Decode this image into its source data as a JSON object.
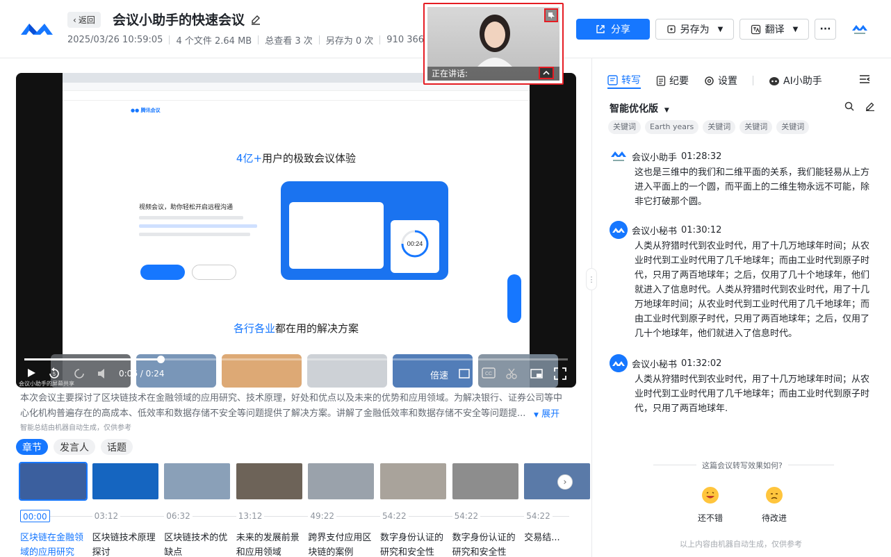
{
  "header": {
    "back_label": "返回",
    "title": "会议小助手的快速会议",
    "datetime": "2025/03/26 10:59:05",
    "files": "4 个文件 2.64 MB",
    "views": "总查看 3 次",
    "saves": "另存为 0 次",
    "meeting_id": "910 366 156",
    "share_label": "分享",
    "saveas_label": "另存为",
    "translate_label": "翻译",
    "more_label": "···"
  },
  "speaker_window": {
    "label": "正在讲话:"
  },
  "video": {
    "site_headline_accent": "4亿+",
    "site_headline_rest": "用户的极致会议体验",
    "site_sub_accent": "各行各业",
    "site_sub_rest": "都在用的解决方案",
    "time": "0:06 / 0:24",
    "speed": "倍速",
    "caption": "会议小助手的屏幕共享",
    "progress": 0.25
  },
  "summary": {
    "text": "本次会议主要探讨了区块链技术在金融领域的应用研究、技术原理，好处和优点以及未来的优势和应用领域。为解决银行、证券公司等中心化机构普遍存在的高成本、低效率和数据存储不安全等问题提供了解决方案。讲解了金融低效率和数据存储不安全等问题提...",
    "expand_label": "展开",
    "ai_note": "智能总结由机器自动生成，仅供参考"
  },
  "tabs": [
    {
      "label": "章节",
      "active": true
    },
    {
      "label": "发言人",
      "active": false
    },
    {
      "label": "话题",
      "active": false
    }
  ],
  "chapters": [
    {
      "time": "00:00",
      "title": "区块链在金融领域的应用研究",
      "active": true,
      "color": "#3b5f9e"
    },
    {
      "time": "03:12",
      "title": "区块链技术原理探讨",
      "active": false,
      "color": "#1565c0"
    },
    {
      "time": "06:32",
      "title": "区块链技术的优缺点",
      "active": false,
      "color": "#8aa0b8"
    },
    {
      "time": "13:12",
      "title": "未来的发展前景和应用领域",
      "active": false,
      "color": "#6d6358"
    },
    {
      "time": "49:22",
      "title": "跨界支付应用区块链的案例",
      "active": false,
      "color": "#9aa2ab"
    },
    {
      "time": "54:22",
      "title": "数字身份认证的研究和安全性",
      "active": false,
      "color": "#a9a39b"
    },
    {
      "time": "54:22",
      "title": "数字身份认证的研究和安全性",
      "active": false,
      "color": "#8d8d8d"
    },
    {
      "time": "54:22",
      "title": "交易结...",
      "active": false,
      "color": "#5a7aa8"
    }
  ],
  "right_panel": {
    "tabs": [
      {
        "label": "转写",
        "active": true
      },
      {
        "label": "纪要",
        "active": false
      },
      {
        "label": "设置",
        "active": false
      },
      {
        "label": "AI小助手",
        "active": false
      }
    ],
    "version": "智能优化版",
    "keywords": [
      "关键词",
      "Earth years",
      "关键词",
      "关键词",
      "关键词"
    ],
    "entries": [
      {
        "speaker": "会议小助手",
        "time": "01:28:32",
        "text": "这也是三维中的我们和二维平面的关系，我们能轻易从上方进入平面上的一个圆，而平面上的二维生物永远不可能，除非它打破那个圆。"
      },
      {
        "speaker": "会议小秘书",
        "time": "01:30:12",
        "text": "人类从狩猎时代到农业时代，用了十几万地球年时间；从农业时代到工业时代用了几千地球年；而由工业时代到原子时代，只用了两百地球年；之后，仅用了几十个地球年，他们就进入了信息时代。人类从狩猎时代到农业时代，用了十几万地球年时间；从农业时代到工业时代用了几千地球年；而由工业时代到原子时代，只用了两百地球年；之后，仅用了几十个地球年，他们就进入了信息时代。"
      },
      {
        "speaker": "会议小秘书",
        "time": "01:32:02",
        "text": "人类从狩猎时代到农业时代，用了十几万地球年时间；从农业时代到工业时代用了几千地球年；而由工业时代到原子时代，只用了两百地球年."
      }
    ],
    "feedback_question": "这篇会议转写效果如何?",
    "feedback_good": "还不错",
    "feedback_bad": "待改进",
    "feedback_note": "以上内容由机器自动生成，仅供参考"
  },
  "colors": {
    "accent": "#1677ff",
    "highlight_border": "#e51c23"
  }
}
